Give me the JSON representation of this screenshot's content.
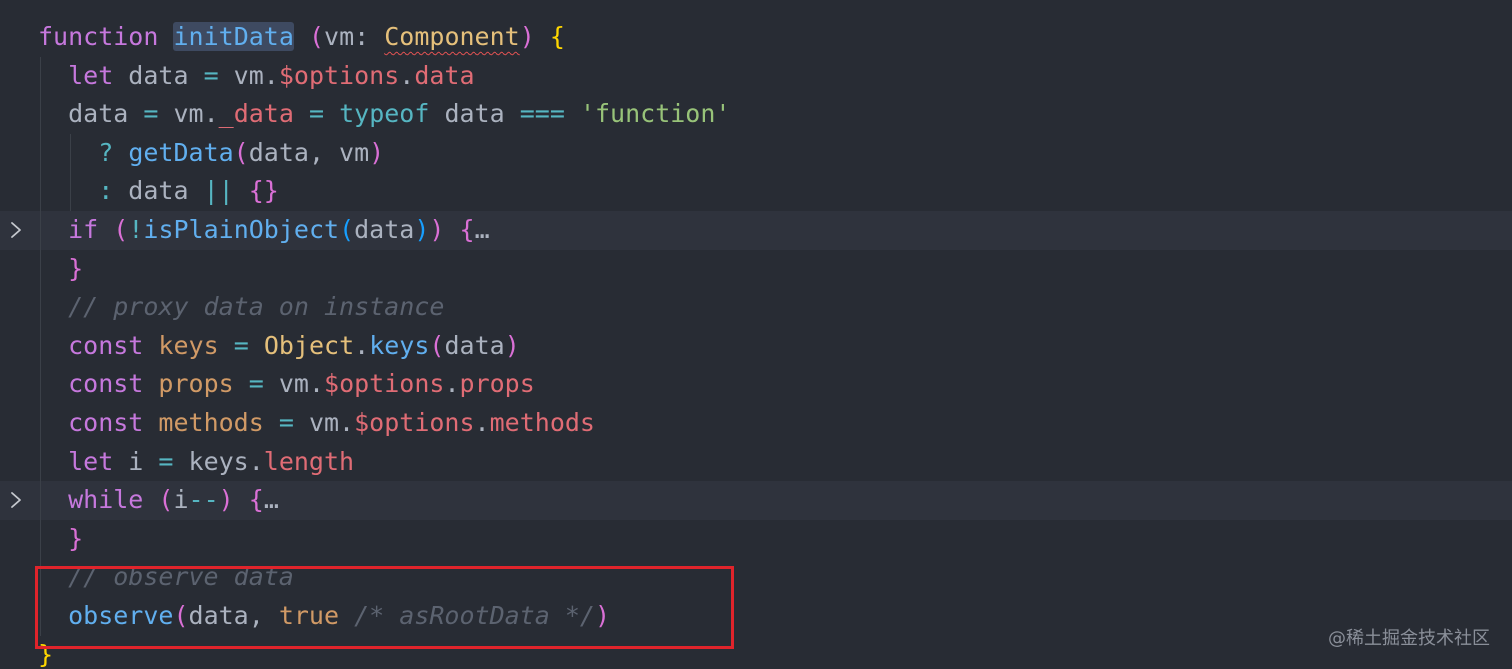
{
  "editor": {
    "theme": {
      "background": "#282c34",
      "highlight_box": "#e0242b"
    },
    "lines": [
      {
        "tokens": [
          {
            "t": "function",
            "c": "kw"
          },
          {
            "t": " "
          },
          {
            "t": "initData",
            "c": "fn sel"
          },
          {
            "t": " "
          },
          {
            "t": "(",
            "c": "brk2"
          },
          {
            "t": "vm",
            "c": "var"
          },
          {
            "t": ": ",
            "c": "var"
          },
          {
            "t": "Component",
            "c": "cls squiggle"
          },
          {
            "t": ")",
            "c": "brk2"
          },
          {
            "t": " "
          },
          {
            "t": "{",
            "c": "brk1"
          }
        ]
      },
      {
        "tokens": [
          {
            "t": "let",
            "c": "kw"
          },
          {
            "t": " data ",
            "c": "var"
          },
          {
            "t": "=",
            "c": "op"
          },
          {
            "t": " vm.",
            "c": "var"
          },
          {
            "t": "$options",
            "c": "prop"
          },
          {
            "t": ".",
            "c": "var"
          },
          {
            "t": "data",
            "c": "prop"
          }
        ]
      },
      {
        "tokens": [
          {
            "t": "data ",
            "c": "var"
          },
          {
            "t": "=",
            "c": "op"
          },
          {
            "t": " vm.",
            "c": "var"
          },
          {
            "t": "_data",
            "c": "prop"
          },
          {
            "t": " "
          },
          {
            "t": "=",
            "c": "op"
          },
          {
            "t": " "
          },
          {
            "t": "typeof",
            "c": "op"
          },
          {
            "t": " data ",
            "c": "var"
          },
          {
            "t": "===",
            "c": "op"
          },
          {
            "t": " "
          },
          {
            "t": "'function'",
            "c": "str"
          }
        ]
      },
      {
        "tokens": [
          {
            "t": "?",
            "c": "op"
          },
          {
            "t": " "
          },
          {
            "t": "getData",
            "c": "fn"
          },
          {
            "t": "(",
            "c": "brk2"
          },
          {
            "t": "data, vm",
            "c": "var"
          },
          {
            "t": ")",
            "c": "brk2"
          }
        ]
      },
      {
        "tokens": [
          {
            "t": ":",
            "c": "op"
          },
          {
            "t": " data ",
            "c": "var"
          },
          {
            "t": "||",
            "c": "op"
          },
          {
            "t": " "
          },
          {
            "t": "{}",
            "c": "brk2"
          }
        ]
      },
      {
        "folded": true,
        "tokens": [
          {
            "t": "if",
            "c": "kw"
          },
          {
            "t": " "
          },
          {
            "t": "(",
            "c": "brk2"
          },
          {
            "t": "!",
            "c": "op"
          },
          {
            "t": "isPlainObject",
            "c": "fn"
          },
          {
            "t": "(",
            "c": "brk3"
          },
          {
            "t": "data",
            "c": "var"
          },
          {
            "t": ")",
            "c": "brk3"
          },
          {
            "t": ")",
            "c": "brk2"
          },
          {
            "t": " "
          },
          {
            "t": "{",
            "c": "brk2"
          },
          {
            "t": "…",
            "c": "ell"
          }
        ]
      },
      {
        "tokens": [
          {
            "t": "}",
            "c": "brk2"
          }
        ]
      },
      {
        "tokens": [
          {
            "t": "// proxy data on instance",
            "c": "cmt"
          }
        ]
      },
      {
        "tokens": [
          {
            "t": "const",
            "c": "kw"
          },
          {
            "t": " "
          },
          {
            "t": "keys",
            "c": "cst"
          },
          {
            "t": " "
          },
          {
            "t": "=",
            "c": "op"
          },
          {
            "t": " "
          },
          {
            "t": "Object",
            "c": "cls"
          },
          {
            "t": ".",
            "c": "var"
          },
          {
            "t": "keys",
            "c": "fn"
          },
          {
            "t": "(",
            "c": "brk2"
          },
          {
            "t": "data",
            "c": "var"
          },
          {
            "t": ")",
            "c": "brk2"
          }
        ]
      },
      {
        "tokens": [
          {
            "t": "const",
            "c": "kw"
          },
          {
            "t": " "
          },
          {
            "t": "props",
            "c": "cst"
          },
          {
            "t": " "
          },
          {
            "t": "=",
            "c": "op"
          },
          {
            "t": " vm.",
            "c": "var"
          },
          {
            "t": "$options",
            "c": "prop"
          },
          {
            "t": ".",
            "c": "var"
          },
          {
            "t": "props",
            "c": "prop"
          }
        ]
      },
      {
        "tokens": [
          {
            "t": "const",
            "c": "kw"
          },
          {
            "t": " "
          },
          {
            "t": "methods",
            "c": "cst"
          },
          {
            "t": " "
          },
          {
            "t": "=",
            "c": "op"
          },
          {
            "t": " vm.",
            "c": "var"
          },
          {
            "t": "$options",
            "c": "prop"
          },
          {
            "t": ".",
            "c": "var"
          },
          {
            "t": "methods",
            "c": "prop"
          }
        ]
      },
      {
        "tokens": [
          {
            "t": "let",
            "c": "kw"
          },
          {
            "t": " i ",
            "c": "var"
          },
          {
            "t": "=",
            "c": "op"
          },
          {
            "t": " keys.",
            "c": "var"
          },
          {
            "t": "length",
            "c": "prop"
          }
        ]
      },
      {
        "folded": true,
        "tokens": [
          {
            "t": "while",
            "c": "kw"
          },
          {
            "t": " "
          },
          {
            "t": "(",
            "c": "brk2"
          },
          {
            "t": "i",
            "c": "var"
          },
          {
            "t": "--",
            "c": "op"
          },
          {
            "t": ")",
            "c": "brk2"
          },
          {
            "t": " "
          },
          {
            "t": "{",
            "c": "brk2"
          },
          {
            "t": "…",
            "c": "ell"
          }
        ]
      },
      {
        "tokens": [
          {
            "t": "}",
            "c": "brk2"
          }
        ]
      },
      {
        "tokens": [
          {
            "t": "// observe data",
            "c": "cmt"
          }
        ]
      },
      {
        "tokens": [
          {
            "t": "observe",
            "c": "fn"
          },
          {
            "t": "(",
            "c": "brk2"
          },
          {
            "t": "data, ",
            "c": "var"
          },
          {
            "t": "true",
            "c": "cst"
          },
          {
            "t": " "
          },
          {
            "t": "/* asRootData */",
            "c": "cmt"
          },
          {
            "t": ")",
            "c": "brk2"
          }
        ]
      },
      {
        "tokens": [
          {
            "t": "}",
            "c": "brk1"
          }
        ]
      }
    ]
  },
  "watermark": "@稀土掘金技术社区"
}
